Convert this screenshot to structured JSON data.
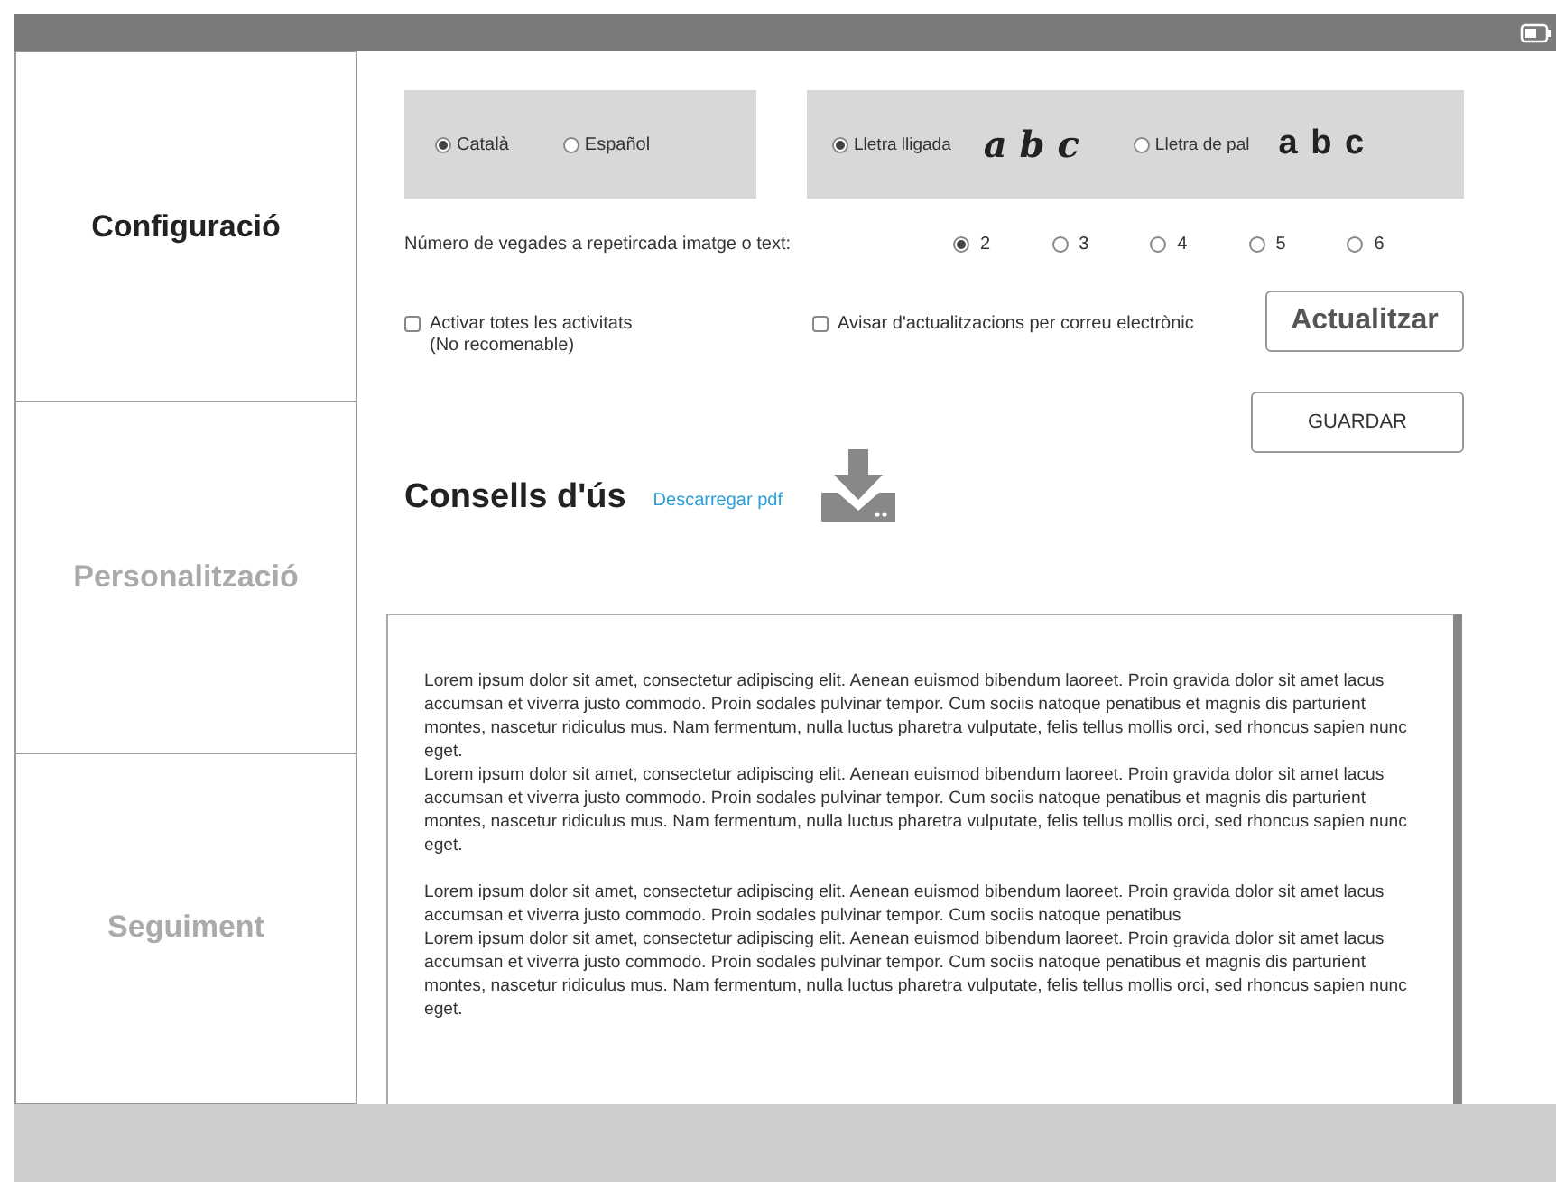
{
  "sidebar": {
    "items": [
      {
        "label": "Configuració",
        "selected": true
      },
      {
        "label": "Personalització",
        "selected": false
      },
      {
        "label": "Seguiment",
        "selected": false
      }
    ]
  },
  "language": {
    "options": [
      {
        "label": "Català",
        "selected": true
      },
      {
        "label": "Español",
        "selected": false
      }
    ]
  },
  "letter_style": {
    "options": [
      {
        "label": "Lletra lligada",
        "selected": true,
        "kind": "cursive",
        "sample": "a b c"
      },
      {
        "label": "Lletra de pal",
        "selected": false,
        "kind": "print",
        "sample": "a b c"
      }
    ]
  },
  "repeat": {
    "label": "Número de vegades a repetircada imatge o text:",
    "options": [
      {
        "label": "2",
        "selected": true
      },
      {
        "label": "3",
        "selected": false
      },
      {
        "label": "4",
        "selected": false
      },
      {
        "label": "5",
        "selected": false
      },
      {
        "label": "6",
        "selected": false
      }
    ]
  },
  "checkboxes": [
    {
      "lines": [
        "Activar totes les activitats",
        "(No recomenable)"
      ],
      "checked": false
    },
    {
      "lines": [
        "Avisar d'actualitzacions per correu electrònic"
      ],
      "checked": false
    }
  ],
  "update_button": "Actualitzar",
  "save_button": "GUARDAR",
  "tips": {
    "title": "Consells d'ús",
    "link": "Descarregar pdf",
    "blocks": [
      [
        "Lorem ipsum dolor sit amet, consectetur adipiscing elit. Aenean euismod bibendum laoreet. Proin gravida dolor sit amet lacus accumsan et viverra justo commodo. Proin sodales pulvinar tempor. Cum sociis natoque penatibus et magnis dis parturient montes, nascetur ridiculus mus. Nam fermentum, nulla luctus pharetra vulputate, felis tellus mollis orci, sed rhoncus sapien nunc eget.",
        "Lorem ipsum dolor sit amet, consectetur adipiscing elit. Aenean euismod bibendum laoreet. Proin gravida dolor sit amet lacus accumsan et viverra justo commodo. Proin sodales pulvinar tempor. Cum sociis natoque penatibus et magnis dis parturient montes, nascetur ridiculus mus. Nam fermentum, nulla luctus pharetra vulputate, felis tellus mollis orci, sed rhoncus sapien nunc eget."
      ],
      [
        "Lorem ipsum dolor sit amet, consectetur adipiscing elit. Aenean euismod bibendum laoreet. Proin gravida dolor sit amet lacus accumsan et viverra justo commodo. Proin sodales pulvinar tempor. Cum sociis natoque penatibus",
        "Lorem ipsum dolor sit amet, consectetur adipiscing elit. Aenean euismod bibendum laoreet. Proin gravida dolor sit amet lacus accumsan et viverra justo commodo. Proin sodales pulvinar tempor. Cum sociis natoque penatibus et magnis dis parturient montes, nascetur ridiculus mus. Nam fermentum, nulla luctus pharetra vulputate, felis tellus mollis orci, sed rhoncus sapien nunc eget."
      ]
    ]
  }
}
